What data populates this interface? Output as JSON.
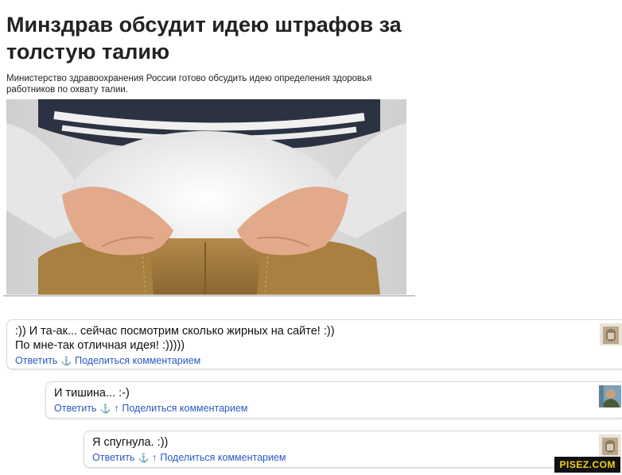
{
  "article": {
    "title": "Минздрав обсудит идею штрафов за толстую талию",
    "lead": "Министерство здравоохранения России готово обсудить идею определения здоровья работников по охвату талии."
  },
  "comments": [
    {
      "line1": ":)) И та-ак... сейчас посмотрим сколько жирных на сайте! :))",
      "line2": "По мне-так отличная идея! :)))))",
      "reply": "Ответить",
      "share": "Поделиться комментарием"
    },
    {
      "line1": "И тишина... :-)",
      "reply": "Ответить",
      "share": "Поделиться комментарием"
    },
    {
      "line1": "Я спугнула. :))",
      "reply": "Ответить",
      "share": "Поделиться комментарием"
    }
  ],
  "icons": {
    "anchor": "anchor-icon",
    "parent": "up-arrow-icon"
  },
  "watermark": "PISEZ.COM",
  "colors": {
    "link": "#2a59c4",
    "text": "#222222",
    "watermark_bg": "#111111",
    "watermark_fg": "#f2d21b"
  }
}
